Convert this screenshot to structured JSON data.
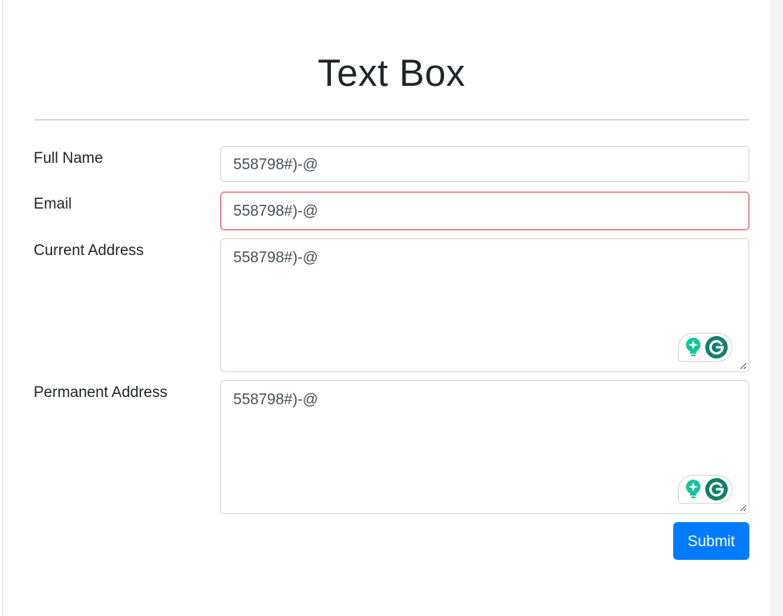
{
  "page": {
    "title": "Text Box"
  },
  "form": {
    "full_name": {
      "label": "Full Name",
      "value": "558798#)-@"
    },
    "email": {
      "label": "Email",
      "value": "558798#)-@",
      "state": "invalid"
    },
    "current_address": {
      "label": "Current Address",
      "value": "558798#)-@"
    },
    "permanent_address": {
      "label": "Permanent Address",
      "value": "558798#)-@"
    },
    "submit_label": "Submit"
  },
  "colors": {
    "primary_button": "#007bff",
    "invalid_border": "#dc3545",
    "input_border": "#ced4da",
    "grammarly_green": "#15c39a",
    "grammarly_dark": "#11806a"
  },
  "icons": {
    "assistant": "grammarly-bulb-icon",
    "grammarly": "grammarly-g-icon",
    "resize": "resize-handle-icon"
  }
}
